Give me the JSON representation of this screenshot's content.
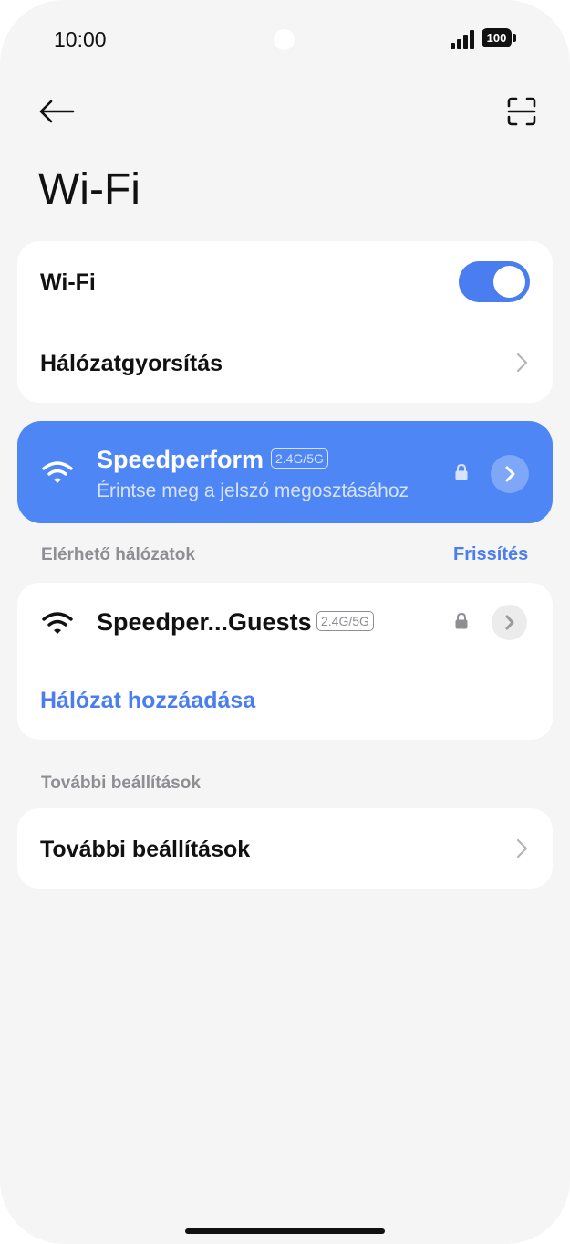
{
  "status_bar": {
    "time": "10:00",
    "battery": "100"
  },
  "header": {
    "title": "Wi-Fi",
    "back_icon": "back-arrow-icon",
    "scan_icon": "qr-scan-icon"
  },
  "wifi_card": {
    "toggle_label": "Wi-Fi",
    "toggle_on": true,
    "acceleration_label": "Hálózatgyorsítás"
  },
  "connected_network": {
    "name": "Speedperform",
    "band": "2.4G/5G",
    "subtitle": "Érintse meg a jelszó megosztásához",
    "secured": true
  },
  "available_section": {
    "label": "Elérhető hálózatok",
    "refresh_label": "Frissítés",
    "networks": [
      {
        "name": "Speedper...Guests",
        "band": "2.4G/5G",
        "secured": true
      }
    ],
    "add_network_label": "Hálózat hozzáadása"
  },
  "more_section": {
    "label": "További beállítások",
    "item_label": "További beállítások"
  },
  "colors": {
    "accent": "#4a7ef0",
    "connected_bg": "#4f86f5",
    "background": "#f5f5f5"
  }
}
